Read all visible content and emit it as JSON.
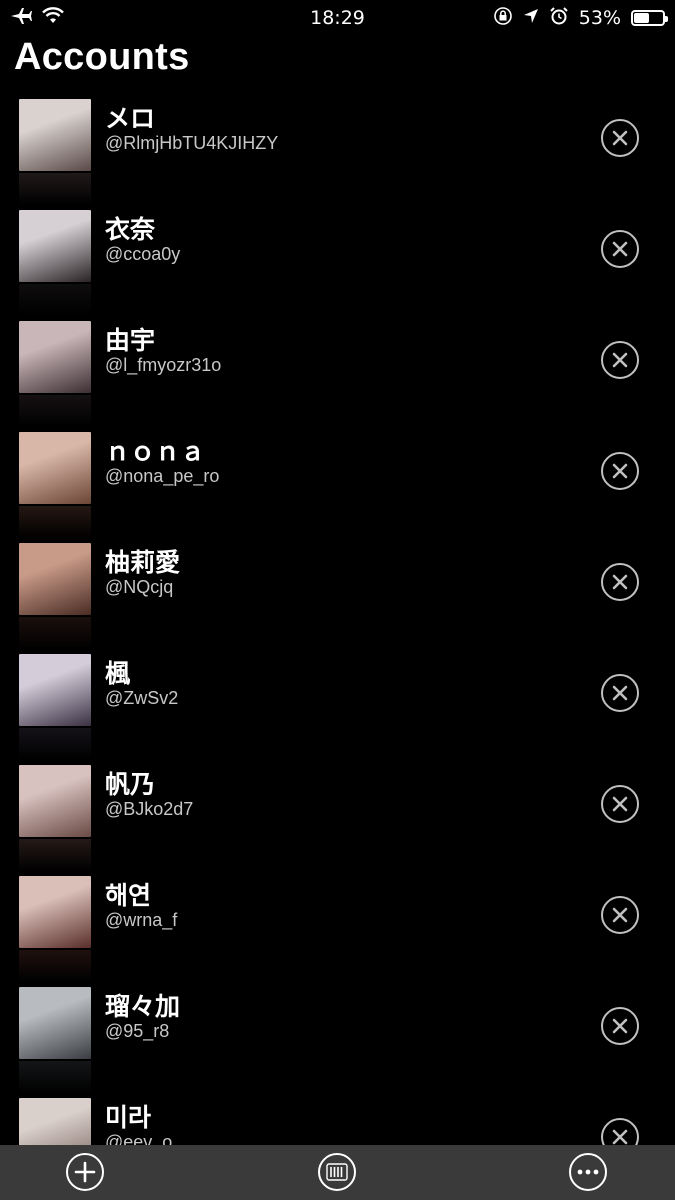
{
  "status": {
    "time": "18:29",
    "battery": "53%",
    "battery_level": 0.53,
    "icons": [
      "airplane-icon",
      "wifi-icon",
      "orientation-lock-icon",
      "location-icon",
      "alarm-icon",
      "battery-icon"
    ]
  },
  "page": {
    "title": "Accounts"
  },
  "accounts": [
    {
      "name": "メロ",
      "handle": "@RlmjHbTU4KJIHZY",
      "avatar_colors": [
        "#d9d2ce",
        "#5a4a48"
      ]
    },
    {
      "name": "衣奈",
      "handle": "@ccoa0y",
      "avatar_colors": [
        "#d6d0d4",
        "#2a2326"
      ]
    },
    {
      "name": "由宇",
      "handle": "@l_fmyozr31o",
      "avatar_colors": [
        "#c9b6b8",
        "#3d2f33"
      ]
    },
    {
      "name": "ｎｏｎａ",
      "handle": "@nona_pe_ro",
      "avatar_colors": [
        "#d9b7a8",
        "#6b4536"
      ]
    },
    {
      "name": "柚莉愛",
      "handle": "@NQcjq",
      "avatar_colors": [
        "#c89a88",
        "#4a2c24"
      ]
    },
    {
      "name": "楓",
      "handle": "@ZwSv2",
      "avatar_colors": [
        "#d4ccd8",
        "#3a3244"
      ]
    },
    {
      "name": "帆乃",
      "handle": "@BJko2d7",
      "avatar_colors": [
        "#d8c2bf",
        "#6a4a45"
      ]
    },
    {
      "name": "해연",
      "handle": "@wrna_f",
      "avatar_colors": [
        "#d9bfb8",
        "#5a2e2a"
      ]
    },
    {
      "name": "瑠々加",
      "handle": "@95_r8",
      "avatar_colors": [
        "#b8bcc0",
        "#3a3d42"
      ]
    },
    {
      "name": "미라",
      "handle": "@eev_o",
      "avatar_colors": [
        "#d9cfcb",
        "#7a6660"
      ]
    }
  ],
  "tab_bar": {
    "buttons": [
      "add-icon",
      "columns-icon",
      "more-icon"
    ]
  },
  "colors": {
    "background": "#000000",
    "tab_bar": "#3a3a3a",
    "handle_text": "#c8c8c8",
    "remove_ring": "#c0c0c0"
  }
}
